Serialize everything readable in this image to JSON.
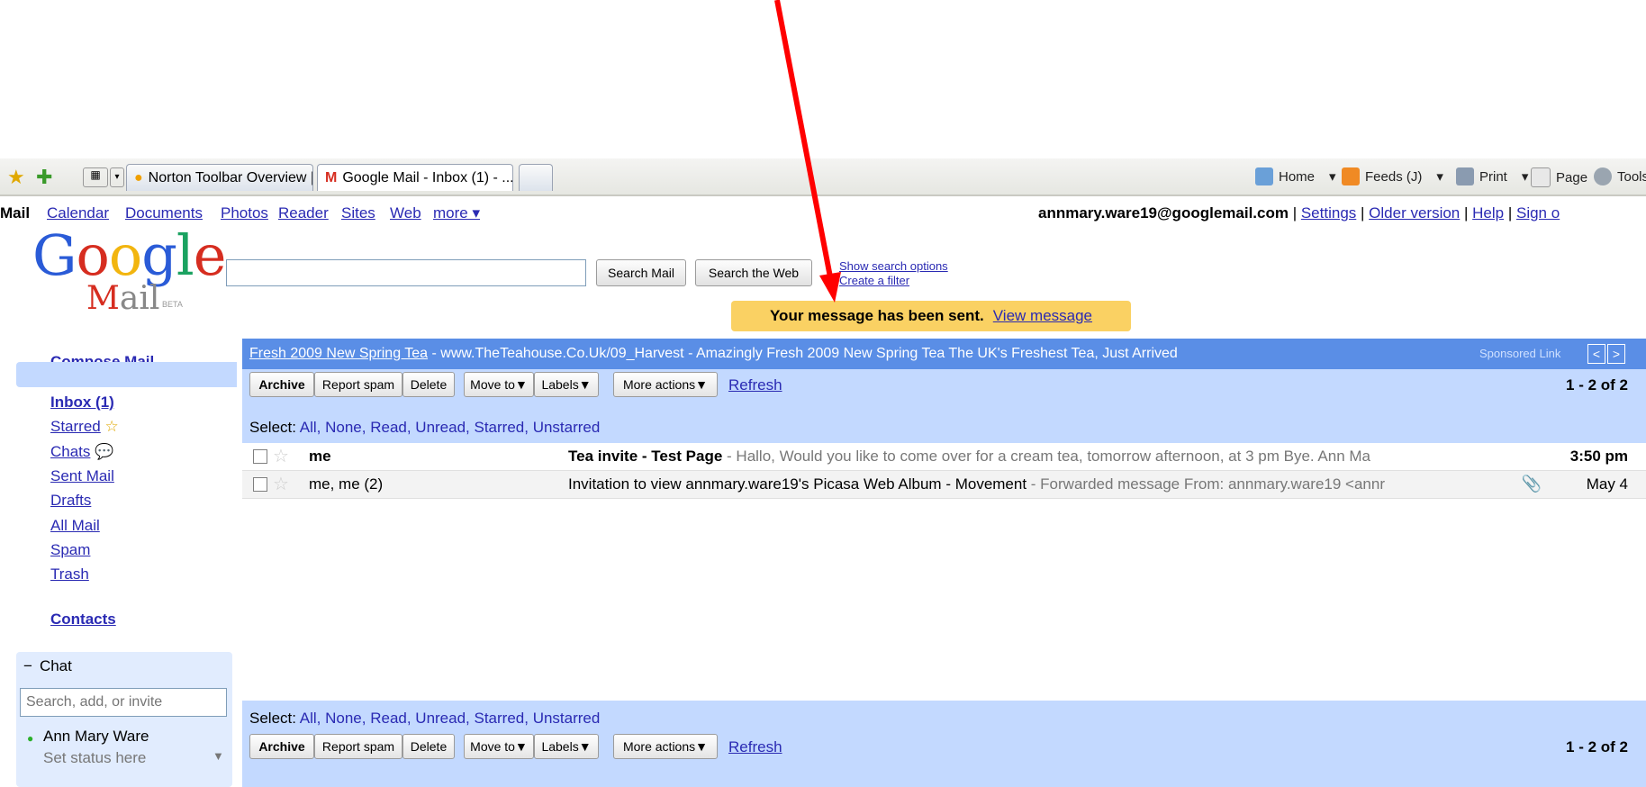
{
  "browser": {
    "tabs": [
      {
        "label": "Norton Toolbar Overview | N..."
      },
      {
        "label": "Google Mail - Inbox (1) - ..."
      }
    ],
    "toolbar": {
      "home": "Home",
      "feeds": "Feeds (J)",
      "print": "Print",
      "page": "Page",
      "tools": "Tools"
    }
  },
  "nav": {
    "items": [
      "Mail",
      "Calendar",
      "Documents",
      "Photos",
      "Reader",
      "Sites",
      "Web",
      "more ▾"
    ],
    "account_email": "annmary.ware19@googlemail.com",
    "account_links": [
      "Settings",
      "Older version",
      "Help",
      "Sign o"
    ]
  },
  "logo": {
    "word": "Google",
    "mail": "Mail",
    "beta": "BETA"
  },
  "search": {
    "value": "",
    "search_mail": "Search Mail",
    "search_web": "Search the Web",
    "show_options": "Show search options",
    "create_filter": "Create a filter"
  },
  "notice": {
    "text": "Your message has been sent.",
    "link": "View message"
  },
  "sidebar": {
    "compose": "Compose Mail",
    "items": [
      "Inbox (1)",
      "Starred",
      "Chats",
      "Sent Mail",
      "Drafts",
      "All Mail",
      "Spam",
      "Trash"
    ],
    "contacts": "Contacts",
    "chat": {
      "title": "Chat",
      "collapse": "−",
      "search_placeholder": "Search, add, or invite",
      "user": "Ann Mary Ware",
      "status": "Set status here"
    }
  },
  "ad": {
    "link": "Fresh 2009 New Spring Tea",
    "text": " - www.TheTeahouse.Co.Uk/09_Harvest - Amazingly Fresh 2009 New Spring Tea The UK's Freshest Tea, Just Arrived",
    "sponsored": "Sponsored Link"
  },
  "actions": {
    "archive": "Archive",
    "report_spam": "Report spam",
    "delete": "Delete",
    "move_to": "Move to▼",
    "labels": "Labels▼",
    "more_actions": "More actions▼",
    "refresh": "Refresh",
    "count": "1 - 2 of 2"
  },
  "select": {
    "label": "Select:",
    "options": "All, None, Read, Unread, Starred, Unstarred"
  },
  "messages": [
    {
      "from": "me",
      "subject": "Tea invite - Test Page",
      "snippet": " - Hallo, Would you like to come over for a cream tea, tomorrow afternoon, at 3 pm Bye. Ann Ma",
      "time": "3:50 pm",
      "unread": true
    },
    {
      "from": "me, me (2)",
      "subject": "Invitation to view annmary.ware19's Picasa Web Album - Movement",
      "snippet": " - Forwarded message From: annmary.ware19 <annr",
      "time": "May 4",
      "unread": false
    }
  ],
  "colors": {
    "accent": "#5a8ee6",
    "panel": "#c3d9ff",
    "notice": "#fad163",
    "annotation": "#ff0000"
  }
}
